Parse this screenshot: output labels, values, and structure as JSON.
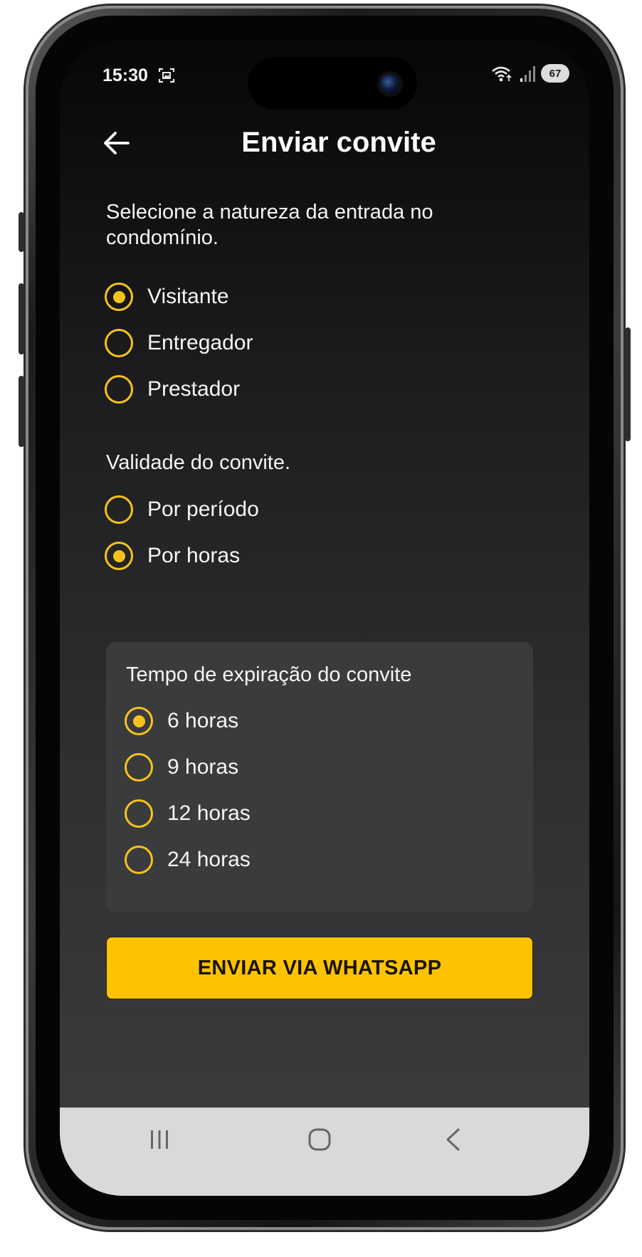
{
  "status_bar": {
    "time": "15:30",
    "battery": "67"
  },
  "header": {
    "title": "Enviar convite"
  },
  "entry_type": {
    "prompt": "Selecione a natureza da entrada no condomínio.",
    "options": [
      {
        "label": "Visitante",
        "selected": true
      },
      {
        "label": "Entregador",
        "selected": false
      },
      {
        "label": "Prestador",
        "selected": false
      }
    ]
  },
  "validity": {
    "prompt": "Validade do convite.",
    "options": [
      {
        "label": "Por período",
        "selected": false
      },
      {
        "label": "Por horas",
        "selected": true
      }
    ]
  },
  "expiration": {
    "title": "Tempo de expiração do convite",
    "options": [
      {
        "label": "6 horas",
        "selected": true
      },
      {
        "label": "9 horas",
        "selected": false
      },
      {
        "label": "12 horas",
        "selected": false
      },
      {
        "label": "24 horas",
        "selected": false
      }
    ]
  },
  "actions": {
    "send_label": "ENVIAR VIA WHATSAPP"
  },
  "colors": {
    "accent": "#fdc300",
    "radio": "#f7c21c",
    "background_top": "#070707",
    "background_bottom": "#3c3d3f",
    "panel": "#3a3b3d",
    "nav_bar": "#d9d9d9"
  },
  "icons": {
    "back": "arrow-left-icon",
    "status_screenshot": "screenshot-icon",
    "wifi": "wifi-icon",
    "signal": "signal-icon",
    "nav_recents": "recents-icon",
    "nav_home": "home-icon",
    "nav_back": "chevron-left-icon"
  }
}
